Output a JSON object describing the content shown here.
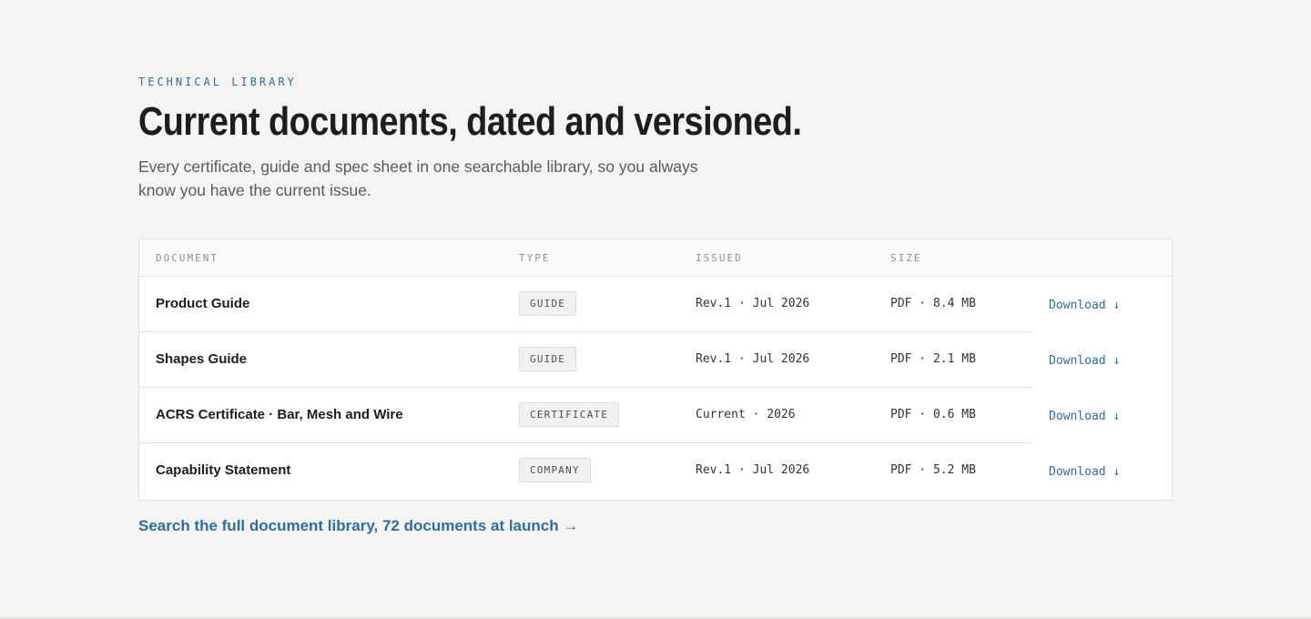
{
  "eyebrow": "TECHNICAL LIBRARY",
  "title": "Current documents, dated and versioned.",
  "intro": "Every certificate, guide and spec sheet in one searchable library, so you always know you have the current issue.",
  "table": {
    "headers": {
      "document": "DOCUMENT",
      "type": "TYPE",
      "issued": "ISSUED",
      "size": "SIZE"
    },
    "rows": [
      {
        "name": "Product Guide",
        "type": "GUIDE",
        "issued": "Rev.1 · Jul 2026",
        "size": "PDF · 8.4 MB",
        "action": "Download ↓"
      },
      {
        "name": "Shapes Guide",
        "type": "GUIDE",
        "issued": "Rev.1 · Jul 2026",
        "size": "PDF · 2.1 MB",
        "action": "Download ↓"
      },
      {
        "name": "ACRS Certificate · Bar, Mesh and Wire",
        "type": "CERTIFICATE",
        "issued": "Current · 2026",
        "size": "PDF · 0.6 MB",
        "action": "Download ↓"
      },
      {
        "name": "Capability Statement",
        "type": "COMPANY",
        "issued": "Rev.1 · Jul 2026",
        "size": "PDF · 5.2 MB",
        "action": "Download ↓"
      }
    ]
  },
  "search_link": "Search the full document library, 72 documents at launch →",
  "colors": {
    "accent": "#2b6ea6",
    "background": "#f4f4f2",
    "card": "#ffffff",
    "text": "#1d1d1d"
  }
}
